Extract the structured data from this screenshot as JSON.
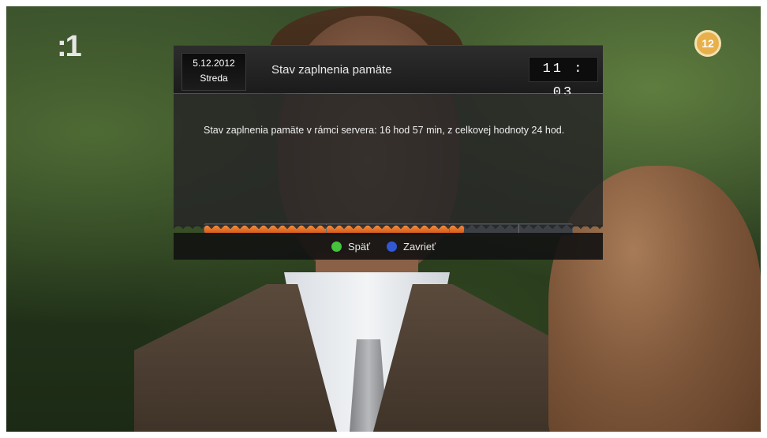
{
  "channel": {
    "logo_text": ":1",
    "age_rating": "12"
  },
  "dialog": {
    "date": "5.12.2012",
    "weekday": "Streda",
    "title": "Stav zaplnenia pamäte",
    "time": "11 : 03",
    "message": "Stav zaplnenia pamäte v rámci servera: 16 hod 57 min, z celkovej hodnoty 24 hod.",
    "progress_fraction": 0.7063,
    "colors": {
      "progress": "#e06a24",
      "green_key": "#45c33a",
      "blue_key": "#3158d6"
    }
  },
  "footer": {
    "buttons": [
      {
        "label": "Späť",
        "icon": "green-dot-icon"
      },
      {
        "label": "Zavrieť",
        "icon": "blue-dot-icon"
      }
    ]
  }
}
